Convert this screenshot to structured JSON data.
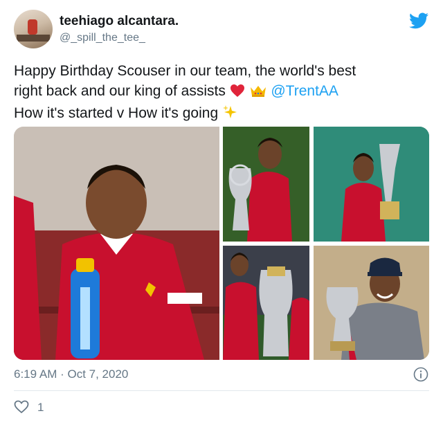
{
  "author": {
    "display_name": "teehiago alcantara.",
    "handle": "@_spill_the_tee_"
  },
  "tweet": {
    "line1": "Happy Birthday Scouser in our team, the world's best",
    "line2_pre": "right back and our king of assists",
    "line2_mention": "@TrentAA",
    "line3": "How it's started v How it's going"
  },
  "icons": {
    "brand": "twitter-bird-icon",
    "heart_emoji": "red-heart-emoji",
    "crown_emoji": "crown-emoji",
    "sparkles_emoji": "sparkles-emoji",
    "info": "info-icon",
    "like": "heart-outline-icon"
  },
  "media": {
    "photos": [
      {
        "subject": "young-boy-in-red-kit-with-bottle"
      },
      {
        "subject": "player-with-champions-league-trophy"
      },
      {
        "subject": "player-with-club-world-cup-trophy"
      },
      {
        "subject": "player-with-premier-league-trophy"
      },
      {
        "subject": "player-with-award-trophy"
      }
    ]
  },
  "footer": {
    "timestamp": "6:19 AM · Oct 7, 2020",
    "like_count": "1"
  },
  "colors": {
    "brand_blue": "#1da1f2",
    "text": "#14171a",
    "muted": "#657786",
    "divider": "#e1e8ed"
  }
}
